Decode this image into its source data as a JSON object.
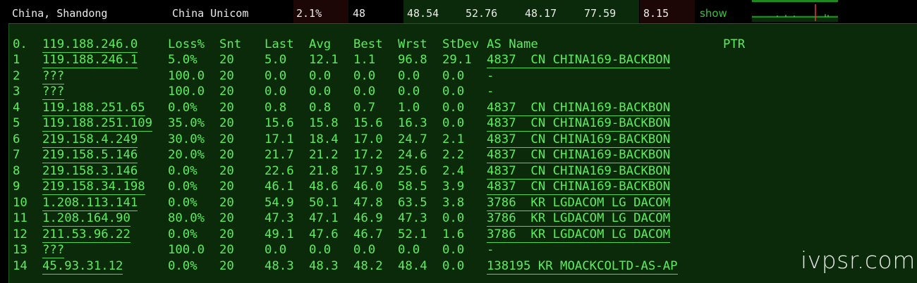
{
  "summary": {
    "location": "China, Shandong",
    "isp": "China Unicom",
    "loss": "2.1%",
    "sent": "48",
    "last": "48.54",
    "avg": "52.76",
    "best": "48.17",
    "worst": "77.59",
    "stdev": "8.15",
    "show_label": "show",
    "colors": {
      "loss_bg": "#1c0606",
      "latency_bg": "#0b2a0b",
      "accent": "#39c13b"
    }
  },
  "table": {
    "headers": {
      "hop": "0.",
      "host": "119.188.246.0",
      "loss": "Loss%",
      "snt": "Snt",
      "last": "Last",
      "avg": "Avg",
      "best": "Best",
      "wrst": "Wrst",
      "stdev": "StDev",
      "asname": "AS Name",
      "ptr": "PTR"
    },
    "rows": [
      {
        "hop": "1",
        "host": "119.188.246.1",
        "loss": "5.0%",
        "snt": "20",
        "last": "5.0",
        "avg": "12.1",
        "best": "1.1",
        "wrst": "96.8",
        "stdev": "29.1",
        "asname": "4837  CN CHINA169-BACKBON"
      },
      {
        "hop": "2",
        "host": "???",
        "loss": "100.0",
        "snt": "20",
        "last": "0.0",
        "avg": "0.0",
        "best": "0.0",
        "wrst": "0.0",
        "stdev": "0.0",
        "asname": "-"
      },
      {
        "hop": "3",
        "host": "???",
        "loss": "100.0",
        "snt": "20",
        "last": "0.0",
        "avg": "0.0",
        "best": "0.0",
        "wrst": "0.0",
        "stdev": "0.0",
        "asname": "-"
      },
      {
        "hop": "4",
        "host": "119.188.251.65",
        "loss": "0.0%",
        "snt": "20",
        "last": "0.8",
        "avg": "0.8",
        "best": "0.7",
        "wrst": "1.0",
        "stdev": "0.0",
        "asname": "4837  CN CHINA169-BACKBON"
      },
      {
        "hop": "5",
        "host": "119.188.251.109",
        "loss": "35.0%",
        "snt": "20",
        "last": "15.6",
        "avg": "15.8",
        "best": "15.6",
        "wrst": "16.3",
        "stdev": "0.0",
        "asname": "4837  CN CHINA169-BACKBON"
      },
      {
        "hop": "6",
        "host": "219.158.4.249",
        "loss": "30.0%",
        "snt": "20",
        "last": "17.1",
        "avg": "18.4",
        "best": "17.0",
        "wrst": "24.7",
        "stdev": "2.1",
        "asname": "4837  CN CHINA169-BACKBON"
      },
      {
        "hop": "7",
        "host": "219.158.5.146",
        "loss": "20.0%",
        "snt": "20",
        "last": "21.7",
        "avg": "21.2",
        "best": "17.2",
        "wrst": "24.6",
        "stdev": "2.2",
        "asname": "4837  CN CHINA169-BACKBON"
      },
      {
        "hop": "8",
        "host": "219.158.3.146",
        "loss": "0.0%",
        "snt": "20",
        "last": "22.6",
        "avg": "21.8",
        "best": "17.9",
        "wrst": "25.6",
        "stdev": "2.4",
        "asname": "4837  CN CHINA169-BACKBON"
      },
      {
        "hop": "9",
        "host": "219.158.34.198",
        "loss": "0.0%",
        "snt": "20",
        "last": "46.1",
        "avg": "48.6",
        "best": "46.0",
        "wrst": "58.5",
        "stdev": "3.9",
        "asname": "4837  CN CHINA169-BACKBON"
      },
      {
        "hop": "10",
        "host": "1.208.113.141",
        "loss": "0.0%",
        "snt": "20",
        "last": "54.9",
        "avg": "50.1",
        "best": "47.8",
        "wrst": "63.5",
        "stdev": "3.8",
        "asname": "3786  KR LGDACOM LG DACOM"
      },
      {
        "hop": "11",
        "host": "1.208.164.90",
        "loss": "80.0%",
        "snt": "20",
        "last": "47.3",
        "avg": "47.1",
        "best": "46.9",
        "wrst": "47.3",
        "stdev": "0.0",
        "asname": "3786  KR LGDACOM LG DACOM"
      },
      {
        "hop": "12",
        "host": "211.53.96.22",
        "loss": "0.0%",
        "snt": "20",
        "last": "49.1",
        "avg": "47.6",
        "best": "46.7",
        "wrst": "52.1",
        "stdev": "1.6",
        "asname": "3786  KR LGDACOM LG DACOM"
      },
      {
        "hop": "13",
        "host": "???",
        "loss": "100.0",
        "snt": "20",
        "last": "0.0",
        "avg": "0.0",
        "best": "0.0",
        "wrst": "0.0",
        "stdev": "0.0",
        "asname": "-"
      },
      {
        "hop": "14",
        "host": "45.93.31.12",
        "loss": "0.0%",
        "snt": "20",
        "last": "48.3",
        "avg": "48.3",
        "best": "48.2",
        "wrst": "48.4",
        "stdev": "0.0",
        "asname": "138195 KR MOACKCOLTD-AS-AP"
      }
    ]
  },
  "watermark": "ivpsr.com",
  "colors": {
    "panel_bg": "#0a2a0a",
    "text": "#5dec5d"
  }
}
